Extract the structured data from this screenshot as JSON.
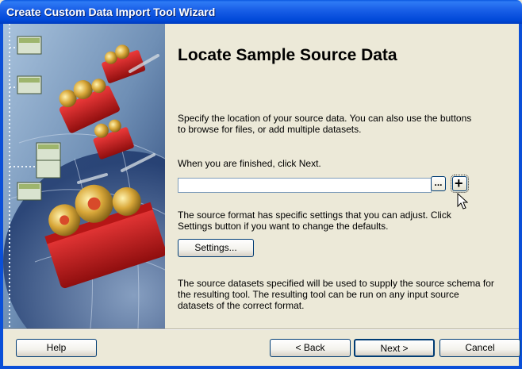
{
  "window": {
    "title": "Create Custom Data Import Tool Wizard"
  },
  "page": {
    "heading": "Locate Sample Source Data",
    "intro": "Specify the location of your source data. You can also use the buttons to browse for files, or add multiple datasets.",
    "finish_hint": "When you are finished, click Next.",
    "source_path": {
      "value": "",
      "placeholder": ""
    },
    "browse_label": "...",
    "add_label": "+",
    "settings_hint": "The source format has specific settings that you can adjust. Click Settings button if you want to change the defaults.",
    "settings_label": "Settings...",
    "footer_note": "The source datasets specified will be used to supply the source schema for the resulting tool. The resulting tool can be run on any input source datasets of the correct format."
  },
  "buttons": {
    "help": "Help",
    "back": "< Back",
    "next": "Next >",
    "cancel": "Cancel"
  },
  "colors": {
    "titlebar": "#0a58e0",
    "dialog_bg": "#ece9d8",
    "toolbox_red": "#cc2020"
  }
}
